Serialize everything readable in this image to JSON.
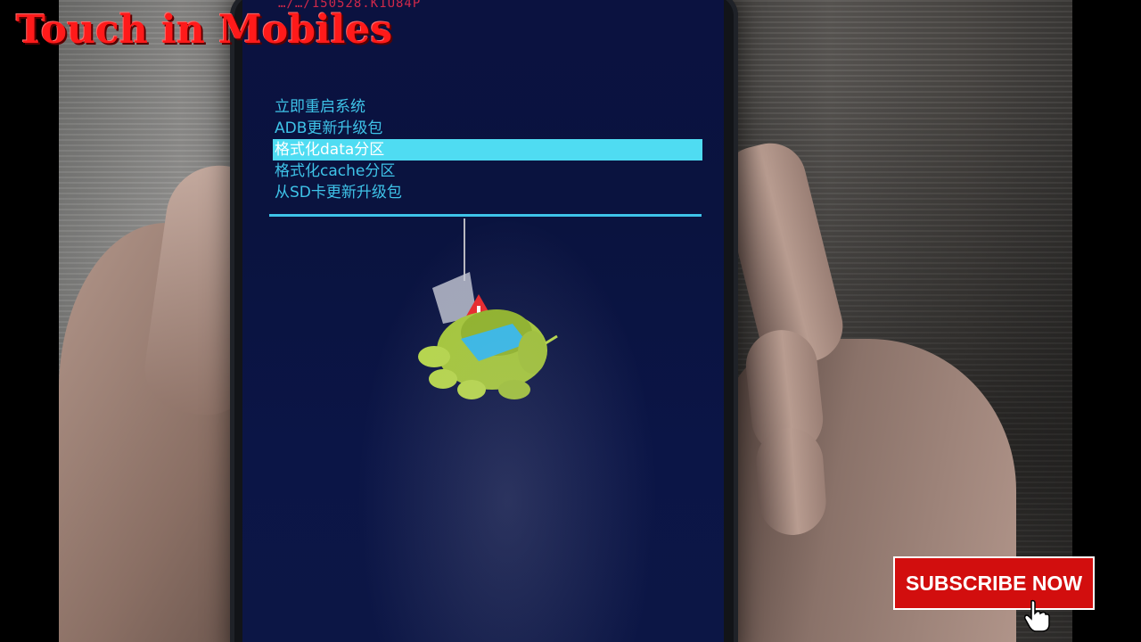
{
  "watermark": {
    "text": "Touch in Mobiles"
  },
  "recovery": {
    "header_text": "…/…/150528.K1U84P",
    "menu_items": [
      {
        "label": "立即重启系统",
        "selected": false
      },
      {
        "label": "ADB更新升级包",
        "selected": false
      },
      {
        "label": "格式化data分区",
        "selected": true
      },
      {
        "label": "格式化cache分区",
        "selected": false
      },
      {
        "label": "从SD卡更新升级包",
        "selected": false
      }
    ],
    "accent_color": "#3ec3e8",
    "selection_color": "#4fdcf2"
  },
  "overlay": {
    "subscribe_label": "SUBSCRIBE NOW",
    "subscribe_color": "#d20e0e"
  },
  "icons": {
    "android_robot": "android-error-icon",
    "warning": "warning-icon",
    "cursor": "hand-cursor-icon"
  }
}
